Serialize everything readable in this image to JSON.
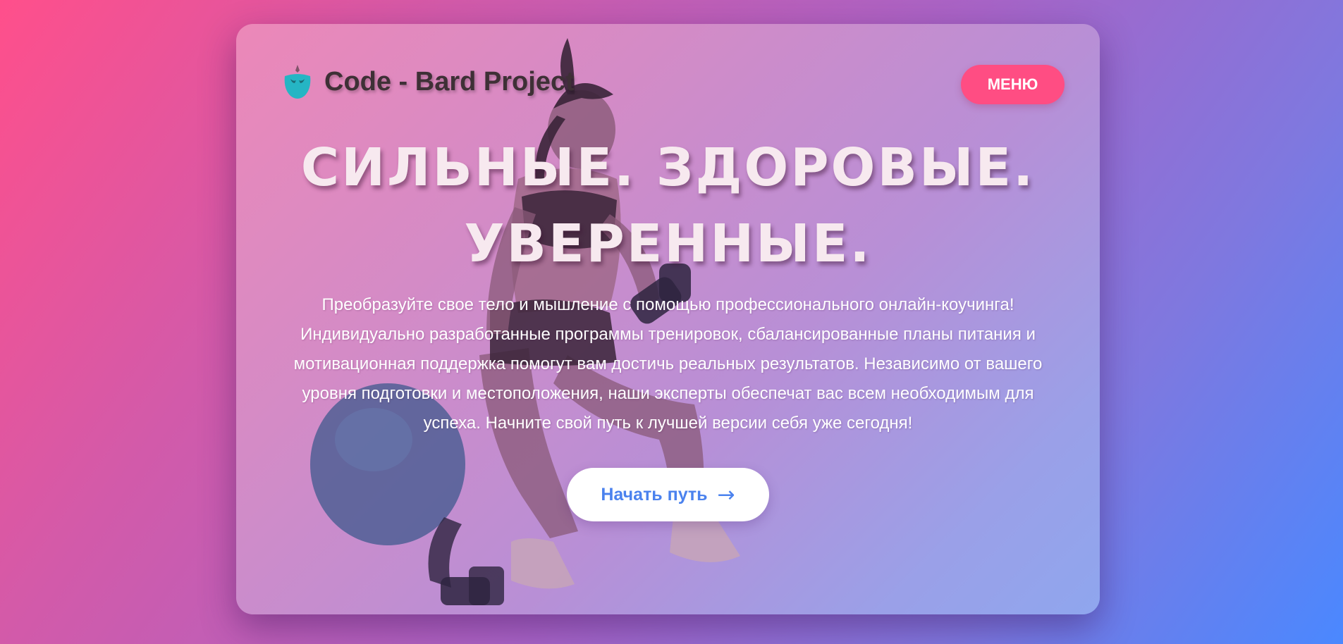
{
  "header": {
    "brand_name": "Code - Bard Project",
    "logo_icon": "mask-logo-icon",
    "menu_label": "МЕНЮ"
  },
  "hero": {
    "title_line1": "СИЛЬНЫЕ. ЗДОРОВЫЕ.",
    "title_line2": "УВЕРЕННЫЕ.",
    "description": "Преобразуйте свое тело и мышление с помощью профессионального онлайн-коучинга! Индивидуально разработанные программы тренировок, сбалансированные планы питания и мотивационная поддержка помогут вам достичь реальных результатов. Независимо от вашего уровня подготовки и местоположения, наши эксперты обеспечат вас всем необходимым для успеха. Начните свой путь к лучшей версии себя уже сегодня!",
    "cta_label": "Начать путь",
    "cta_arrow": "→"
  },
  "colors": {
    "accent_pink": "#ff4d83",
    "cta_text_blue": "#4b82ee",
    "title_text": "#f7e9ef"
  }
}
